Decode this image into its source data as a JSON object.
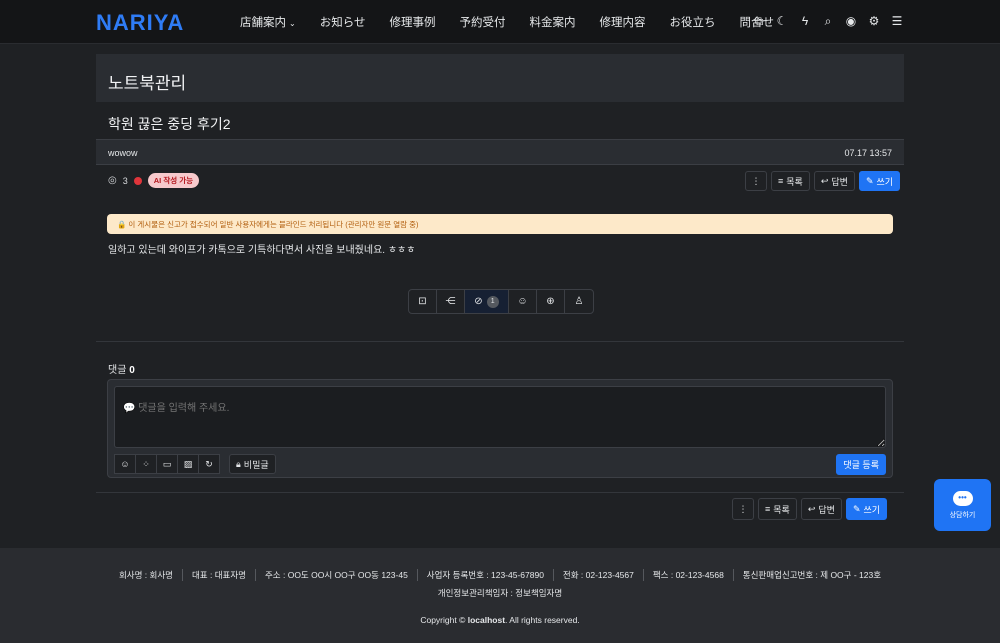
{
  "header": {
    "logo": "NARIYA",
    "nav": [
      "店舗案内",
      "お知らせ",
      "修理事例",
      "予約受付",
      "料金案内",
      "修理内容",
      "お役立ち",
      "問合せ"
    ],
    "nav_chevron": "⌄",
    "icons": [
      "translate-icon",
      "moon-icon",
      "bolt-icon",
      "search-icon",
      "user-icon",
      "gear-icon",
      "menu-icon"
    ]
  },
  "board": {
    "title": "노트북관리"
  },
  "post": {
    "title": "학원 끊은 중딩 후기2",
    "author": "wowow",
    "date": "07.17 13:57",
    "views": "3",
    "ai_badge": "AI 작성 가능",
    "notice": "🔒 이 게시물은 신고가 접수되어 일반 사용자에게는 블라인드 처리됩니다 (관리자만 원문 열람 중)",
    "body": "일하고 있는데 와이프가 카톡으로 기특하다면서 사진을 보내줬네요. ㅎㅎㅎ",
    "action_count": "1"
  },
  "buttons": {
    "more": "⋮",
    "list": "목록",
    "reply": "답변",
    "write": "쓰기"
  },
  "comments": {
    "label": "댓글",
    "count": "0",
    "placeholder": "💬 댓글을 입력해 주세요.",
    "secret": "비밀글",
    "submit": "댓글 등록"
  },
  "chat_fab": {
    "label": "상담하기",
    "bubble": "•••"
  },
  "footer": {
    "row1": [
      "회사명 : 회사명",
      "대표 : 대표자명",
      "주소 : OO도 OO시 OO구 OO동 123-45",
      "사업자 등록번호 : 123-45-67890",
      "전화 : 02-123-4567",
      "팩스 : 02-123-4568",
      "통신판매업신고번호 : 제 OO구 - 123호"
    ],
    "row2": "개인정보관리책임자 : 정보책임자명",
    "copyright_pre": "Copyright ©",
    "copyright_host": "localhost",
    "copyright_post": ". All rights reserved."
  },
  "colors": {
    "accent": "#1f74f4",
    "logo": "#2f7cf6",
    "badge_red": "#e0353b",
    "notice_bg": "#fde9c9"
  }
}
